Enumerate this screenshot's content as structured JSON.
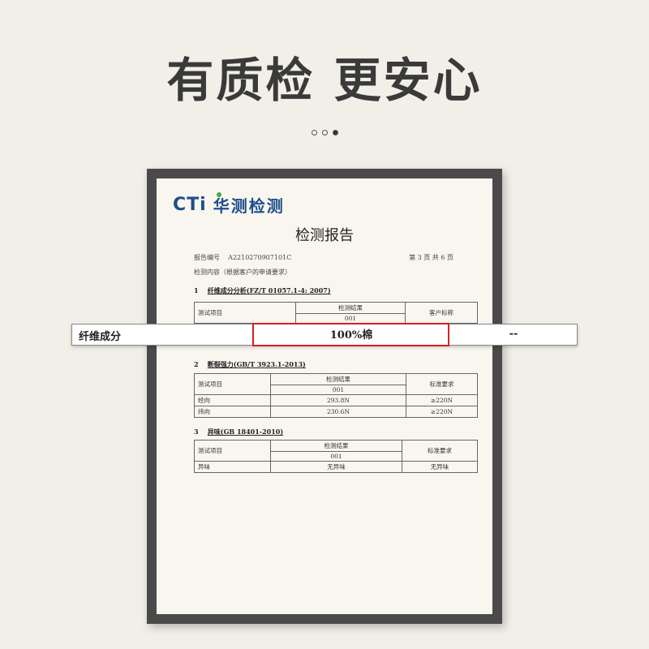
{
  "headline": "有质检 更安心",
  "pager": {
    "count": 3,
    "active": 2
  },
  "logo": {
    "brand": "CTi",
    "cn": "华测检测"
  },
  "report": {
    "title": "检测报告",
    "report_no_label": "报告编号",
    "report_no": "A2210270907101C",
    "page": "第 3 页  共 6 页",
    "content": "检测内容（根据客户的申请要求）"
  },
  "sections": [
    {
      "num": "1",
      "title": "纤维成分分析(FZ/T 01057.1-4: 2007)"
    },
    {
      "num": "2",
      "title": "断裂强力(GB/T 3923.1-2013)"
    },
    {
      "num": "3",
      "title": "异味(GB 18401-2010)"
    }
  ],
  "table1": {
    "item_header": "测试项目",
    "result_header": "检测结果",
    "sample": "001",
    "std_header": "客户标称"
  },
  "table2": {
    "item_header": "测试项目",
    "result_header": "检测结果",
    "sample": "001",
    "std_header": "标准要求",
    "rows": [
      {
        "item": "经向",
        "result": "293.8N",
        "std": "≥220N"
      },
      {
        "item": "纬向",
        "result": "230.6N",
        "std": "≥220N"
      }
    ]
  },
  "table3": {
    "item_header": "测试项目",
    "result_header": "检测结果",
    "sample": "001",
    "std_header": "标准要求",
    "rows": [
      {
        "item": "异味",
        "result": "无异味",
        "std": "无异味"
      }
    ]
  },
  "zoom": {
    "label": "纤维成分",
    "value": "100%棉",
    "std": "--"
  },
  "colors": {
    "brand": "#1f4e8c",
    "highlight": "#d62222",
    "logo_dot": "#48a848"
  }
}
